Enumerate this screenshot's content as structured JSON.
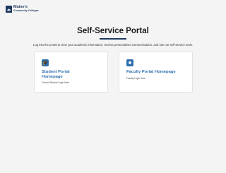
{
  "header": {
    "logo_line1": "Maine's",
    "logo_line2": "Community Colleges"
  },
  "main": {
    "title": "Self-Service Portal",
    "intro": "Log into the portal to view your academic information, receive personalized communication, and use our self-service tools."
  },
  "cards": [
    {
      "icon": "graduation-cap-icon",
      "title": "Student Portal Homepage",
      "subtitle": "Current Student Login Here"
    },
    {
      "icon": "briefcase-icon",
      "title": "Faculty Portal Homepage",
      "subtitle": "Faculty Login Here"
    }
  ],
  "colors": {
    "brand": "#1f3a5f",
    "accent": "#2f6fad",
    "background": "#f4f4f4"
  }
}
